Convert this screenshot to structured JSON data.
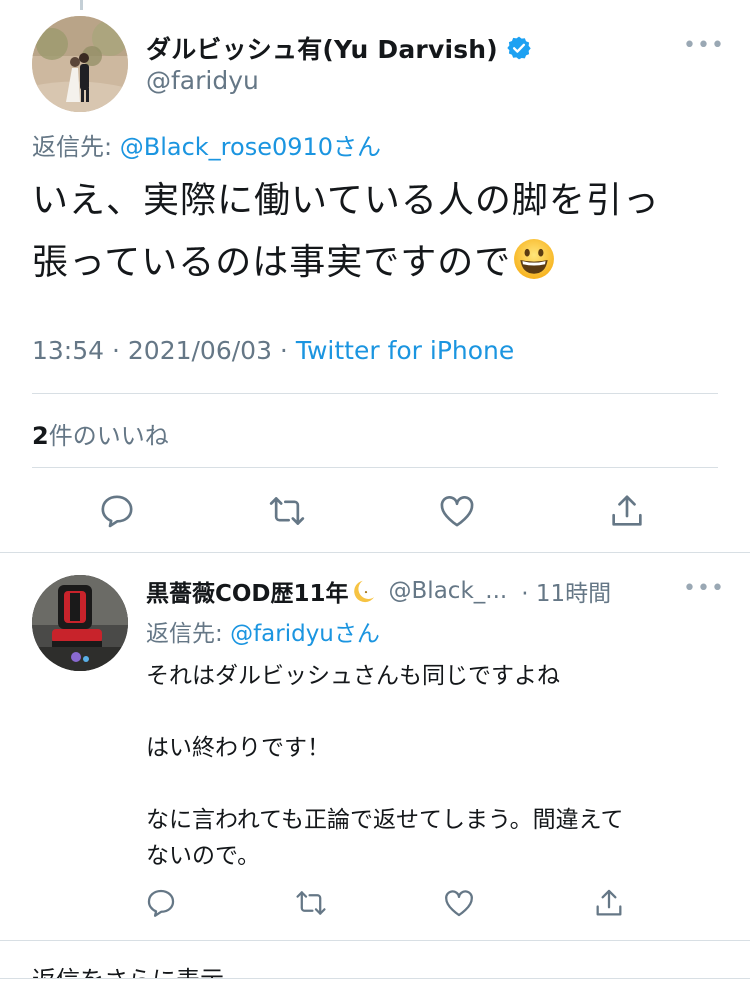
{
  "main_tweet": {
    "display_name": "ダルビッシュ有(Yu Darvish)",
    "handle": "@faridyu",
    "more": "•••",
    "reply_to_label": "返信先:",
    "reply_to_mention": "@Black_rose0910さん",
    "text_line1": "いえ、実際に働いている人の脚を引っ",
    "text_line2": "張っているのは事実ですので",
    "timestamp": "13:54 · 2021/06/03 · ",
    "source": "Twitter for iPhone",
    "likes_count": "2",
    "likes_label": "件のいいね"
  },
  "reply_tweet": {
    "display_name": "黒薔薇COD歴11年",
    "handle": "@Black_...",
    "time": "· 11時間",
    "more": "•••",
    "reply_to_label": "返信先:",
    "reply_to_mention": "@faridyuさん",
    "line1": "それはダルビッシュさんも同じですよね",
    "line2": "はい終わりです！",
    "line3": "なに言われても正論で返せてしまう。間違えて",
    "line4": "ないので。"
  },
  "show_more": "返信をさらに表示",
  "icons": {
    "reply": "reply-icon",
    "retweet": "retweet-icon",
    "like": "heart-icon",
    "share": "share-icon",
    "verified": "verified-badge-icon",
    "moon": "crescent-moon-emoji",
    "grin": "grinning-face-emoji"
  },
  "colors": {
    "link": "#1b95e0",
    "secondary_text": "#657786",
    "primary_text": "#14171a",
    "divider": "#d8dfe4"
  }
}
